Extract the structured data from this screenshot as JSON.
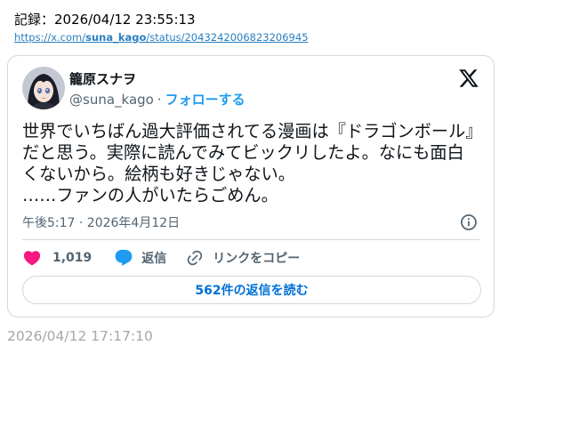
{
  "record": {
    "text": "記録：2026/04/12 23:55:13"
  },
  "source_link": {
    "prefix": "https://x.com/",
    "user": "suna_kago",
    "suffix": "/status/2043242006823206945"
  },
  "tweet": {
    "display_name": "籠原スナヲ",
    "handle": "@suna_kago",
    "separator": "·",
    "follow_label": "フォローする",
    "text": "世界でいちばん過大評価されてる漫画は『ドラゴンボール』だと思う。実際に読んでみてビックリしたよ。なにも面白くないから。絵柄も好きじゃない。\n……ファンの人がいたらごめん。",
    "timestamp": "午後5:17 · 2026年4月12日",
    "likes": "1,019",
    "reply_label": "返信",
    "copy_link_label": "リンクをコピー",
    "read_replies_label": "562件の返信を読む"
  },
  "footer": {
    "time": "2026/04/12 17:17:10"
  },
  "icons": {
    "avatar": "anime-girl-avatar",
    "brand": "x-logo-icon",
    "info": "info-icon",
    "like": "heart-icon",
    "reply": "speech-bubble-icon",
    "copy": "link-icon"
  },
  "colors": {
    "like": "#f91880",
    "reply": "#1d9bf0",
    "follow": "#1d9bf0",
    "link": "#2a7fc0",
    "read_replies": "#006fd6",
    "secondary_text": "#536471",
    "border": "#cfd9de"
  }
}
